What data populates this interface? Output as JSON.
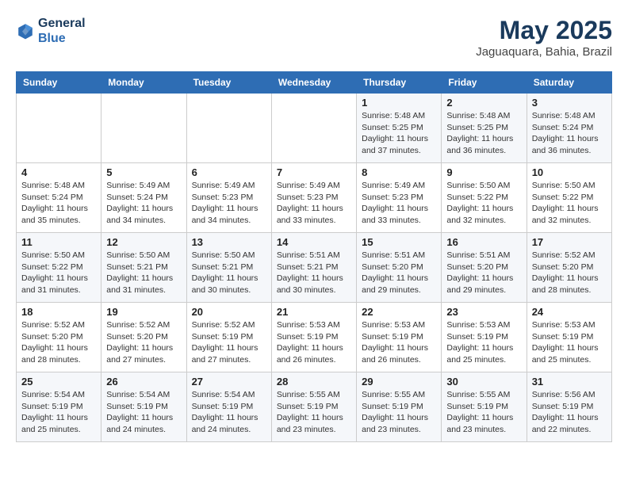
{
  "header": {
    "logo_line1": "General",
    "logo_line2": "Blue",
    "month": "May 2025",
    "location": "Jaguaquara, Bahia, Brazil"
  },
  "weekdays": [
    "Sunday",
    "Monday",
    "Tuesday",
    "Wednesday",
    "Thursday",
    "Friday",
    "Saturday"
  ],
  "weeks": [
    [
      {
        "day": "",
        "info": ""
      },
      {
        "day": "",
        "info": ""
      },
      {
        "day": "",
        "info": ""
      },
      {
        "day": "",
        "info": ""
      },
      {
        "day": "1",
        "info": "Sunrise: 5:48 AM\nSunset: 5:25 PM\nDaylight: 11 hours\nand 37 minutes."
      },
      {
        "day": "2",
        "info": "Sunrise: 5:48 AM\nSunset: 5:25 PM\nDaylight: 11 hours\nand 36 minutes."
      },
      {
        "day": "3",
        "info": "Sunrise: 5:48 AM\nSunset: 5:24 PM\nDaylight: 11 hours\nand 36 minutes."
      }
    ],
    [
      {
        "day": "4",
        "info": "Sunrise: 5:48 AM\nSunset: 5:24 PM\nDaylight: 11 hours\nand 35 minutes."
      },
      {
        "day": "5",
        "info": "Sunrise: 5:49 AM\nSunset: 5:24 PM\nDaylight: 11 hours\nand 34 minutes."
      },
      {
        "day": "6",
        "info": "Sunrise: 5:49 AM\nSunset: 5:23 PM\nDaylight: 11 hours\nand 34 minutes."
      },
      {
        "day": "7",
        "info": "Sunrise: 5:49 AM\nSunset: 5:23 PM\nDaylight: 11 hours\nand 33 minutes."
      },
      {
        "day": "8",
        "info": "Sunrise: 5:49 AM\nSunset: 5:23 PM\nDaylight: 11 hours\nand 33 minutes."
      },
      {
        "day": "9",
        "info": "Sunrise: 5:50 AM\nSunset: 5:22 PM\nDaylight: 11 hours\nand 32 minutes."
      },
      {
        "day": "10",
        "info": "Sunrise: 5:50 AM\nSunset: 5:22 PM\nDaylight: 11 hours\nand 32 minutes."
      }
    ],
    [
      {
        "day": "11",
        "info": "Sunrise: 5:50 AM\nSunset: 5:22 PM\nDaylight: 11 hours\nand 31 minutes."
      },
      {
        "day": "12",
        "info": "Sunrise: 5:50 AM\nSunset: 5:21 PM\nDaylight: 11 hours\nand 31 minutes."
      },
      {
        "day": "13",
        "info": "Sunrise: 5:50 AM\nSunset: 5:21 PM\nDaylight: 11 hours\nand 30 minutes."
      },
      {
        "day": "14",
        "info": "Sunrise: 5:51 AM\nSunset: 5:21 PM\nDaylight: 11 hours\nand 30 minutes."
      },
      {
        "day": "15",
        "info": "Sunrise: 5:51 AM\nSunset: 5:20 PM\nDaylight: 11 hours\nand 29 minutes."
      },
      {
        "day": "16",
        "info": "Sunrise: 5:51 AM\nSunset: 5:20 PM\nDaylight: 11 hours\nand 29 minutes."
      },
      {
        "day": "17",
        "info": "Sunrise: 5:52 AM\nSunset: 5:20 PM\nDaylight: 11 hours\nand 28 minutes."
      }
    ],
    [
      {
        "day": "18",
        "info": "Sunrise: 5:52 AM\nSunset: 5:20 PM\nDaylight: 11 hours\nand 28 minutes."
      },
      {
        "day": "19",
        "info": "Sunrise: 5:52 AM\nSunset: 5:20 PM\nDaylight: 11 hours\nand 27 minutes."
      },
      {
        "day": "20",
        "info": "Sunrise: 5:52 AM\nSunset: 5:19 PM\nDaylight: 11 hours\nand 27 minutes."
      },
      {
        "day": "21",
        "info": "Sunrise: 5:53 AM\nSunset: 5:19 PM\nDaylight: 11 hours\nand 26 minutes."
      },
      {
        "day": "22",
        "info": "Sunrise: 5:53 AM\nSunset: 5:19 PM\nDaylight: 11 hours\nand 26 minutes."
      },
      {
        "day": "23",
        "info": "Sunrise: 5:53 AM\nSunset: 5:19 PM\nDaylight: 11 hours\nand 25 minutes."
      },
      {
        "day": "24",
        "info": "Sunrise: 5:53 AM\nSunset: 5:19 PM\nDaylight: 11 hours\nand 25 minutes."
      }
    ],
    [
      {
        "day": "25",
        "info": "Sunrise: 5:54 AM\nSunset: 5:19 PM\nDaylight: 11 hours\nand 25 minutes."
      },
      {
        "day": "26",
        "info": "Sunrise: 5:54 AM\nSunset: 5:19 PM\nDaylight: 11 hours\nand 24 minutes."
      },
      {
        "day": "27",
        "info": "Sunrise: 5:54 AM\nSunset: 5:19 PM\nDaylight: 11 hours\nand 24 minutes."
      },
      {
        "day": "28",
        "info": "Sunrise: 5:55 AM\nSunset: 5:19 PM\nDaylight: 11 hours\nand 23 minutes."
      },
      {
        "day": "29",
        "info": "Sunrise: 5:55 AM\nSunset: 5:19 PM\nDaylight: 11 hours\nand 23 minutes."
      },
      {
        "day": "30",
        "info": "Sunrise: 5:55 AM\nSunset: 5:19 PM\nDaylight: 11 hours\nand 23 minutes."
      },
      {
        "day": "31",
        "info": "Sunrise: 5:56 AM\nSunset: 5:19 PM\nDaylight: 11 hours\nand 22 minutes."
      }
    ]
  ]
}
